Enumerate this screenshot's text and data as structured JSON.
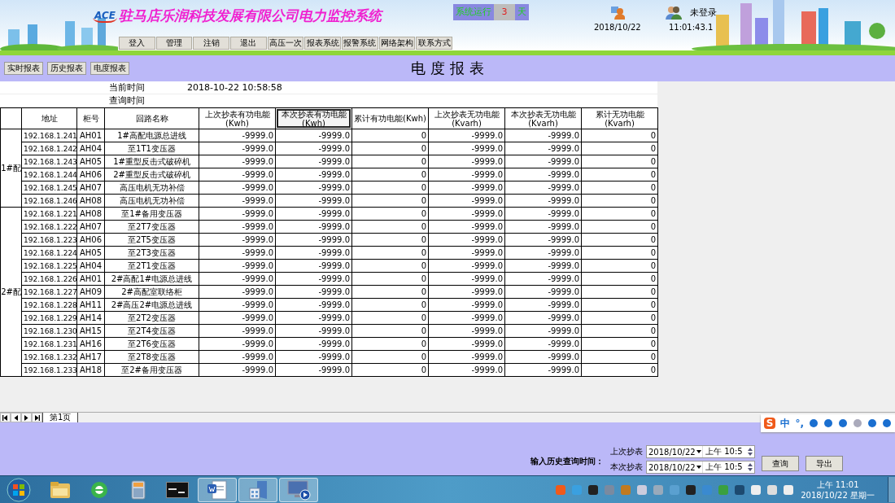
{
  "header": {
    "logo": "ACE",
    "title": "驻马店乐润科技发展有限公司电力监控系统",
    "menu": [
      "登入",
      "管理",
      "注销",
      "退出",
      "高压一次",
      "报表系统",
      "报警系统",
      "网络架构",
      "联系方式"
    ],
    "runtime": {
      "label": "系统运行",
      "days": "3",
      "unit": "天"
    },
    "date": "2018/10/22",
    "time": "11:01:43.1",
    "user": "未登录"
  },
  "toolbar": {
    "buttons": [
      "实时报表",
      "历史报表",
      "电度报表"
    ],
    "title": "电 度 报 表"
  },
  "report": {
    "current_time_label": "当前时间",
    "current_time": "2018-10-22 10:58:58",
    "query_time_label": "查询时间",
    "columns": [
      {
        "label": "地址",
        "selected": false
      },
      {
        "label": "柜号",
        "selected": false
      },
      {
        "label": "回路名称",
        "selected": false
      },
      {
        "label": "上次抄表有功电能\n(Kwh)",
        "selected": false
      },
      {
        "label": "本次抄表有功电能\n(Kwh)",
        "selected": true
      },
      {
        "label": "累计有功电能(Kwh)",
        "selected": false
      },
      {
        "label": "上次抄表无功电能\n(Kvarh)",
        "selected": false
      },
      {
        "label": "本次抄表无功电能\n(Kvarh)",
        "selected": false
      },
      {
        "label": "累计无功电能\n(Kvarh)",
        "selected": false
      }
    ],
    "groups": [
      {
        "name": "1#配",
        "rows": [
          {
            "address": "192.168.1.241",
            "cabinet": "AH01",
            "name": "1#高配电源总进线",
            "values": [
              "-9999.0",
              "-9999.0",
              "0",
              "-9999.0",
              "-9999.0",
              "0"
            ]
          },
          {
            "address": "192.168.1.242",
            "cabinet": "AH04",
            "name": "至1T1变压器",
            "values": [
              "-9999.0",
              "-9999.0",
              "0",
              "-9999.0",
              "-9999.0",
              "0"
            ]
          },
          {
            "address": "192.168.1.243",
            "cabinet": "AH05",
            "name": "1#重型反击式破碎机",
            "values": [
              "-9999.0",
              "-9999.0",
              "0",
              "-9999.0",
              "-9999.0",
              "0"
            ]
          },
          {
            "address": "192.168.1.244",
            "cabinet": "AH06",
            "name": "2#重型反击式破碎机",
            "values": [
              "-9999.0",
              "-9999.0",
              "0",
              "-9999.0",
              "-9999.0",
              "0"
            ]
          },
          {
            "address": "192.168.1.245",
            "cabinet": "AH07",
            "name": "高压电机无功补偿",
            "values": [
              "-9999.0",
              "-9999.0",
              "0",
              "-9999.0",
              "-9999.0",
              "0"
            ]
          },
          {
            "address": "192.168.1.246",
            "cabinet": "AH08",
            "name": "高压电机无功补偿",
            "values": [
              "-9999.0",
              "-9999.0",
              "0",
              "-9999.0",
              "-9999.0",
              "0"
            ]
          }
        ]
      },
      {
        "name": "2#配",
        "rows": [
          {
            "address": "192.168.1.221",
            "cabinet": "AH08",
            "name": "至1#备用变压器",
            "values": [
              "-9999.0",
              "-9999.0",
              "0",
              "-9999.0",
              "-9999.0",
              "0"
            ]
          },
          {
            "address": "192.168.1.222",
            "cabinet": "AH07",
            "name": "至2T7变压器",
            "values": [
              "-9999.0",
              "-9999.0",
              "0",
              "-9999.0",
              "-9999.0",
              "0"
            ]
          },
          {
            "address": "192.168.1.223",
            "cabinet": "AH06",
            "name": "至2T5变压器",
            "values": [
              "-9999.0",
              "-9999.0",
              "0",
              "-9999.0",
              "-9999.0",
              "0"
            ]
          },
          {
            "address": "192.168.1.224",
            "cabinet": "AH05",
            "name": "至2T3变压器",
            "values": [
              "-9999.0",
              "-9999.0",
              "0",
              "-9999.0",
              "-9999.0",
              "0"
            ]
          },
          {
            "address": "192.168.1.225",
            "cabinet": "AH04",
            "name": "至2T1变压器",
            "values": [
              "-9999.0",
              "-9999.0",
              "0",
              "-9999.0",
              "-9999.0",
              "0"
            ]
          },
          {
            "address": "192.168.1.226",
            "cabinet": "AH01",
            "name": "2#高配1#电源总进线",
            "values": [
              "-9999.0",
              "-9999.0",
              "0",
              "-9999.0",
              "-9999.0",
              "0"
            ]
          },
          {
            "address": "192.168.1.227",
            "cabinet": "AH09",
            "name": "2#高配室联络柜",
            "values": [
              "-9999.0",
              "-9999.0",
              "0",
              "-9999.0",
              "-9999.0",
              "0"
            ]
          },
          {
            "address": "192.168.1.228",
            "cabinet": "AH11",
            "name": "2#高压2#电源总进线",
            "values": [
              "-9999.0",
              "-9999.0",
              "0",
              "-9999.0",
              "-9999.0",
              "0"
            ]
          },
          {
            "address": "192.168.1.229",
            "cabinet": "AH14",
            "name": "至2T2变压器",
            "values": [
              "-9999.0",
              "-9999.0",
              "0",
              "-9999.0",
              "-9999.0",
              "0"
            ]
          },
          {
            "address": "192.168.1.230",
            "cabinet": "AH15",
            "name": "至2T4变压器",
            "values": [
              "-9999.0",
              "-9999.0",
              "0",
              "-9999.0",
              "-9999.0",
              "0"
            ]
          },
          {
            "address": "192.168.1.231",
            "cabinet": "AH16",
            "name": "至2T6变压器",
            "values": [
              "-9999.0",
              "-9999.0",
              "0",
              "-9999.0",
              "-9999.0",
              "0"
            ]
          },
          {
            "address": "192.168.1.232",
            "cabinet": "AH17",
            "name": "至2T8变压器",
            "values": [
              "-9999.0",
              "-9999.0",
              "0",
              "-9999.0",
              "-9999.0",
              "0"
            ]
          },
          {
            "address": "192.168.1.233",
            "cabinet": "AH18",
            "name": "至2#备用变压器",
            "values": [
              "-9999.0",
              "-9999.0",
              "0",
              "-9999.0",
              "-9999.0",
              "0"
            ]
          }
        ]
      }
    ]
  },
  "sheet_tabs": [
    {
      "label": "第1页",
      "selected": true
    }
  ],
  "ime": {
    "logo": "S",
    "mode": "中",
    "punct": "°,"
  },
  "query": {
    "label": "输入历史查询时间：",
    "fields": [
      {
        "label": "上次抄表",
        "date": "2018/10/22",
        "time": "上午 10:5"
      },
      {
        "label": "本次抄表",
        "date": "2018/10/22",
        "time": "上午 10:5"
      }
    ],
    "buttons": [
      "查询",
      "导出"
    ]
  },
  "taskbar": {
    "apps": [
      {
        "kind": "folder",
        "running": false
      },
      {
        "kind": "browser",
        "running": false
      },
      {
        "kind": "calculator",
        "running": false
      },
      {
        "kind": "terminal",
        "running": false
      },
      {
        "kind": "document",
        "running": true
      },
      {
        "kind": "files",
        "running": true
      },
      {
        "kind": "monitor",
        "running": true
      }
    ],
    "time": "上午 11:01",
    "date": "2018/10/22 星期一"
  }
}
